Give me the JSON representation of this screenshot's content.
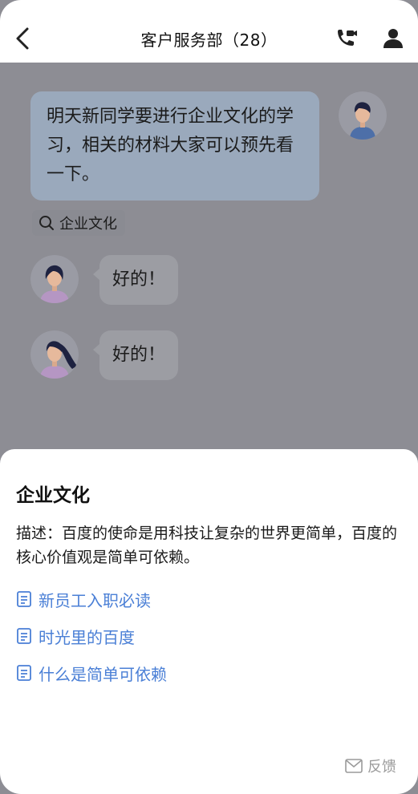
{
  "header": {
    "title": "客户服务部（28）"
  },
  "chat": {
    "messages": [
      {
        "sender": "self",
        "text": "明天新同学要进行企业文化的学习，相关的材料大家可以预先看一下。"
      },
      {
        "sender": "member-1",
        "text": "好的！"
      },
      {
        "sender": "member-2",
        "text": "好的！"
      }
    ],
    "topic_chip": "企业文化"
  },
  "sheet": {
    "title": "企业文化",
    "description": "描述：百度的使命是用科技让复杂的世界更简单，百度的核心价值观是简单可依赖。",
    "links": [
      "新员工入职必读",
      "时光里的百度",
      "什么是简单可依赖"
    ],
    "feedback_label": "反馈"
  },
  "colors": {
    "link": "#4a7fd6",
    "overlay": "#8d8d94",
    "self_bubble": "#9aa9bc"
  },
  "icons": [
    "back-arrow-icon",
    "video-call-icon",
    "member-icon",
    "search-icon",
    "document-icon",
    "mail-icon"
  ]
}
